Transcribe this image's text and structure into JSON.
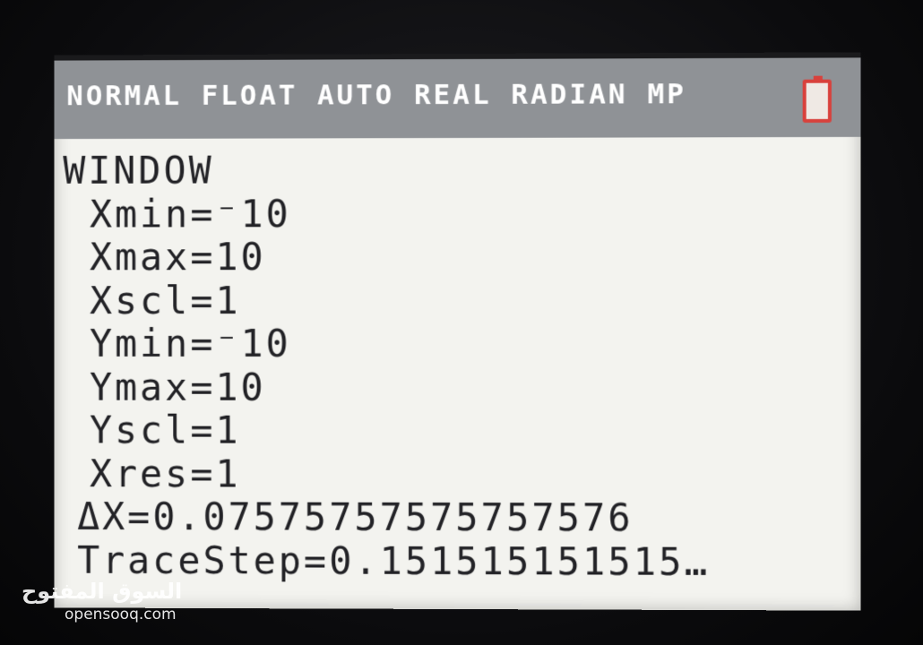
{
  "status_bar": {
    "mode_text": "NORMAL FLOAT AUTO REAL RADIAN MP",
    "battery_icon": "battery-icon"
  },
  "menu": {
    "title": "WINDOW",
    "settings": [
      {
        "name": "Xmin",
        "value": "⁻10"
      },
      {
        "name": "Xmax",
        "value": "10"
      },
      {
        "name": "Xscl",
        "value": "1"
      },
      {
        "name": "Ymin",
        "value": "⁻10"
      },
      {
        "name": "Ymax",
        "value": "10"
      },
      {
        "name": "Yscl",
        "value": "1"
      },
      {
        "name": "Xres",
        "value": "1"
      },
      {
        "name": "ΔX",
        "value": "0.07575757575757576"
      },
      {
        "name": "TraceStep",
        "value": "0.151515151515…"
      }
    ]
  },
  "watermark": {
    "arabic": "السوق المفتوح",
    "latin": "opensooq.com"
  },
  "colors": {
    "status_bar": "#8f9296",
    "screen_background": "#f3f3ef",
    "battery_outline": "#d8413c",
    "text": "#222226"
  }
}
